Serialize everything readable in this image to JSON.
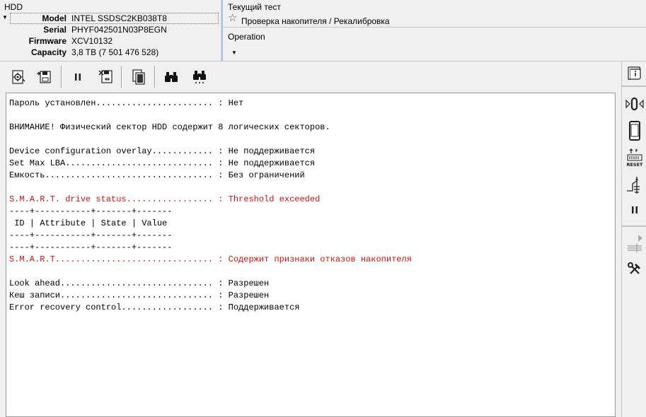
{
  "hdd": {
    "title": "HDD",
    "fields": [
      {
        "label": "Model",
        "value": "INTEL SSDSC2KB038T8"
      },
      {
        "label": "Serial",
        "value": "PHYF042501N03P8EGN"
      },
      {
        "label": "Firmware",
        "value": "XCV10132"
      },
      {
        "label": "Capacity",
        "value": "3,8 TB (7 501 476 528)"
      }
    ]
  },
  "test": {
    "title": "Текущий тест",
    "name": "Проверка накопителя / Рекалибровка",
    "operation_label": "Operation"
  },
  "toolbar": {
    "icons": [
      "gear-disk-icon",
      "save-disk-icon",
      "pause-icon",
      "delete-disk-icon",
      "copy-pages-icon",
      "binoculars-icon",
      "binoculars-next-icon"
    ]
  },
  "sidebar": {
    "icons": [
      "info-scroll-icon",
      "sound-icon",
      "phone-icon",
      "reset-icon",
      "power-switch-icon",
      "pause-icon",
      "play-icon",
      "menu-lines-icon",
      "tools-icon"
    ],
    "reset_label": "RESET"
  },
  "log": {
    "lines": [
      {
        "text": "Пароль установлен....................... : Нет",
        "color": "black"
      },
      {
        "text": "",
        "color": "black"
      },
      {
        "text": "ВНИМАНИЕ! Физический сектор HDD содержит 8 логических секторов.",
        "color": "black"
      },
      {
        "text": "",
        "color": "black"
      },
      {
        "text": "Device configuration overlay............ : Не поддерживается",
        "color": "black"
      },
      {
        "text": "Set Max LBA............................. : Не поддерживается",
        "color": "black"
      },
      {
        "text": "Емкость................................. : Без ограничений",
        "color": "black"
      },
      {
        "text": "",
        "color": "black"
      },
      {
        "text": "S.M.A.R.T. drive status................. : Threshold exceeded",
        "color": "red"
      },
      {
        "text": "----+-----------+-------+-------",
        "color": "black"
      },
      {
        "text": " ID | Attribute | State | Value",
        "color": "black"
      },
      {
        "text": "----+-----------+-------+-------",
        "color": "black"
      },
      {
        "text": "----+-----------+-------+-------",
        "color": "black"
      },
      {
        "text": "S.M.A.R.T............................... : Содержит признаки отказов накопителя",
        "color": "red"
      },
      {
        "text": "",
        "color": "black"
      },
      {
        "text": "Look ahead.............................. : Разрешен",
        "color": "black"
      },
      {
        "text": "Кеш записи.............................. : Разрешен",
        "color": "black"
      },
      {
        "text": "Error recovery control.................. : Поддерживается",
        "color": "black"
      }
    ]
  }
}
